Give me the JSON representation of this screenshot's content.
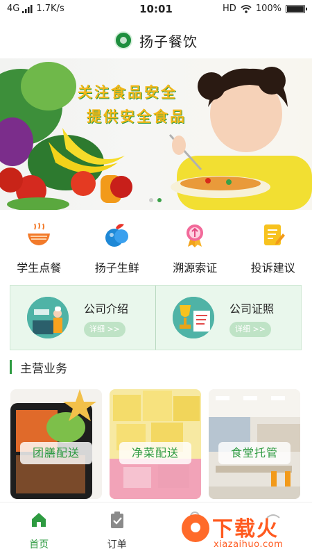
{
  "status_bar": {
    "network": "4G",
    "speed": "1.7K/s",
    "time": "10:01",
    "hd": "HD",
    "battery_percent": "100%",
    "battery_level": 1.0
  },
  "header": {
    "title": "扬子餐饮"
  },
  "banner": {
    "line1": "关注食品安全",
    "line2": "提供安全食品",
    "slide_count": 2,
    "active_slide": 2
  },
  "quick_menu": [
    {
      "label": "学生点餐",
      "icon": "noodle-bowl-icon"
    },
    {
      "label": "扬子生鲜",
      "icon": "vegetable-icon"
    },
    {
      "label": "溯源索证",
      "icon": "medal-icon"
    },
    {
      "label": "投诉建议",
      "icon": "note-pencil-icon"
    }
  ],
  "company": [
    {
      "title": "公司介绍",
      "detail": "详细 >>",
      "icon": "chef-kitchen-icon"
    },
    {
      "title": "公司证照",
      "detail": "详细 >>",
      "icon": "trophy-certificate-icon"
    }
  ],
  "section": {
    "title": "主营业务"
  },
  "business": [
    {
      "label": "团膳配送"
    },
    {
      "label": "净菜配送"
    },
    {
      "label": "食堂托管"
    }
  ],
  "bottom_nav": [
    {
      "label": "首页",
      "icon": "home-icon",
      "active": true
    },
    {
      "label": "订单",
      "icon": "clipboard-icon",
      "active": false
    }
  ],
  "watermark": {
    "text": "下载火",
    "sub": "xiazaihuo.com"
  },
  "colors": {
    "accent": "#2e9b41",
    "banner_text": "#f3b718",
    "panel_bg": "#e9f7ec",
    "watermark": "#ff5a1f"
  }
}
